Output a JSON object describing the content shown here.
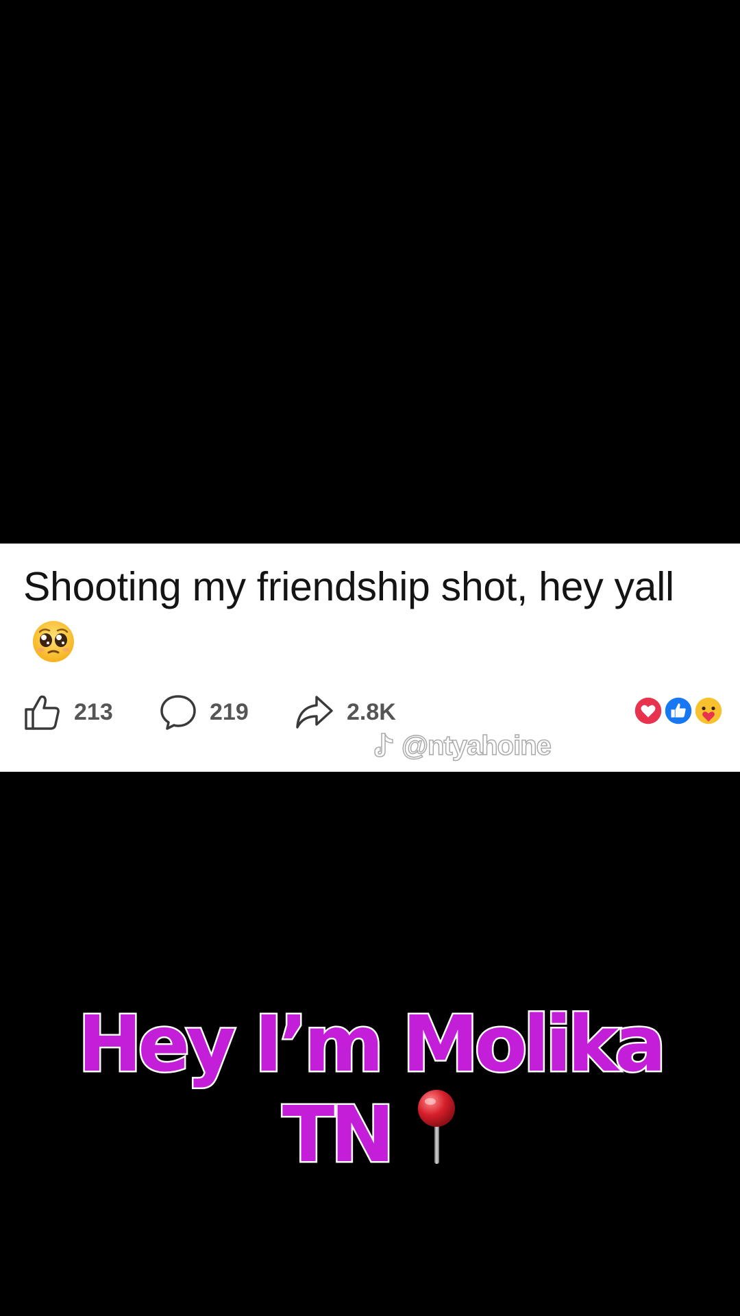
{
  "post": {
    "text": "Shooting my friendship shot, hey yall",
    "text_emoji": "pleading-face-icon",
    "likes_count": "213",
    "comments_count": "219",
    "shares_count": "2.8K",
    "reactions": [
      "love-reaction-icon",
      "like-reaction-icon",
      "care-reaction-icon"
    ],
    "watermark": "@ntyahoine"
  },
  "caption": {
    "line1": "Hey I’m Molika",
    "line2": "TN",
    "line2_icon": "round-pushpin-icon"
  },
  "colors": {
    "background": "#000000",
    "card": "#ffffff",
    "caption_fill": "#c41fd8",
    "caption_stroke": "#ffffff",
    "love_reaction": "#e8334f",
    "like_reaction": "#1877f2"
  }
}
